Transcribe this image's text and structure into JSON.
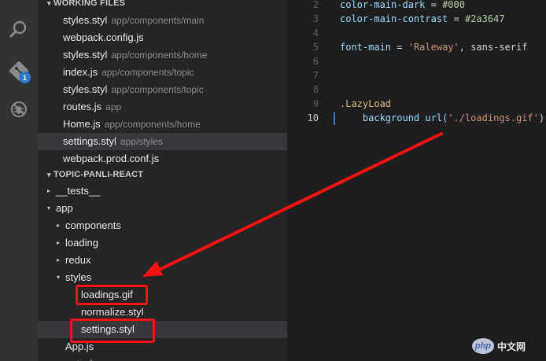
{
  "activity_bar": {
    "search_icon": "search-icon",
    "git_icon": "git-icon",
    "git_badge": "1",
    "debug_icon": "debug-icon"
  },
  "explorer": {
    "working_files": {
      "header": "WORKING FILES",
      "items": [
        {
          "name": "styles.styl",
          "dir": "app/components/main"
        },
        {
          "name": "webpack.config.js",
          "dir": ""
        },
        {
          "name": "styles.styl",
          "dir": "app/components/home"
        },
        {
          "name": "index.js",
          "dir": "app/components/topic"
        },
        {
          "name": "styles.styl",
          "dir": "app/components/topic"
        },
        {
          "name": "routes.js",
          "dir": "app"
        },
        {
          "name": "Home.js",
          "dir": "app/components/home"
        },
        {
          "name": "settings.styl",
          "dir": "app/styles"
        },
        {
          "name": "webpack.prod.conf.js",
          "dir": ""
        }
      ]
    },
    "project": {
      "header": "TOPIC-PANLI-REACT",
      "tree": [
        {
          "name": "__tests__",
          "twisty": "▸",
          "depth": 1
        },
        {
          "name": "app",
          "twisty": "▾",
          "depth": 1
        },
        {
          "name": "components",
          "twisty": "▸",
          "depth": 2
        },
        {
          "name": "loading",
          "twisty": "▸",
          "depth": 2
        },
        {
          "name": "redux",
          "twisty": "▸",
          "depth": 2
        },
        {
          "name": "styles",
          "twisty": "▾",
          "depth": 2
        },
        {
          "name": "loadings.gif",
          "twisty": "",
          "depth": 3
        },
        {
          "name": "normalize.styl",
          "twisty": "",
          "depth": 3
        },
        {
          "name": "settings.styl",
          "twisty": "",
          "depth": 3
        },
        {
          "name": "App.js",
          "twisty": "",
          "depth": 2
        },
        {
          "name": "entry.js",
          "twisty": "",
          "depth": 2
        }
      ]
    }
  },
  "editor": {
    "line_numbers": [
      "2",
      "3",
      "4",
      "5",
      "6",
      "7",
      "8",
      "9",
      "10"
    ],
    "lines": [
      {
        "a": "color-main-dark",
        "b": " = ",
        "c": "#000"
      },
      {
        "a": "color-main-contrast",
        "b": " = ",
        "c": "#2a3647"
      },
      {
        "a": "",
        "b": "",
        "c": ""
      },
      {
        "a": "font-main",
        "b": " = ",
        "c": "'Raleway'",
        "d": ", sans-serif"
      },
      {
        "a": "",
        "b": "",
        "c": ""
      },
      {
        "a": "",
        "b": "",
        "c": ""
      },
      {
        "a": "",
        "b": "",
        "c": ""
      },
      {
        "a": ".LazyLoad",
        "b": "",
        "c": ""
      },
      {
        "a": "    background ",
        "b": "url(",
        "c": "'./loadings.gif'",
        "d": ")"
      }
    ]
  },
  "watermark": {
    "logo": "php",
    "text": "中文网"
  },
  "colors": {
    "annotation": "#ff1010",
    "activity_bar": "#333333",
    "sidebar": "#252526",
    "editor": "#1e1e1e"
  }
}
